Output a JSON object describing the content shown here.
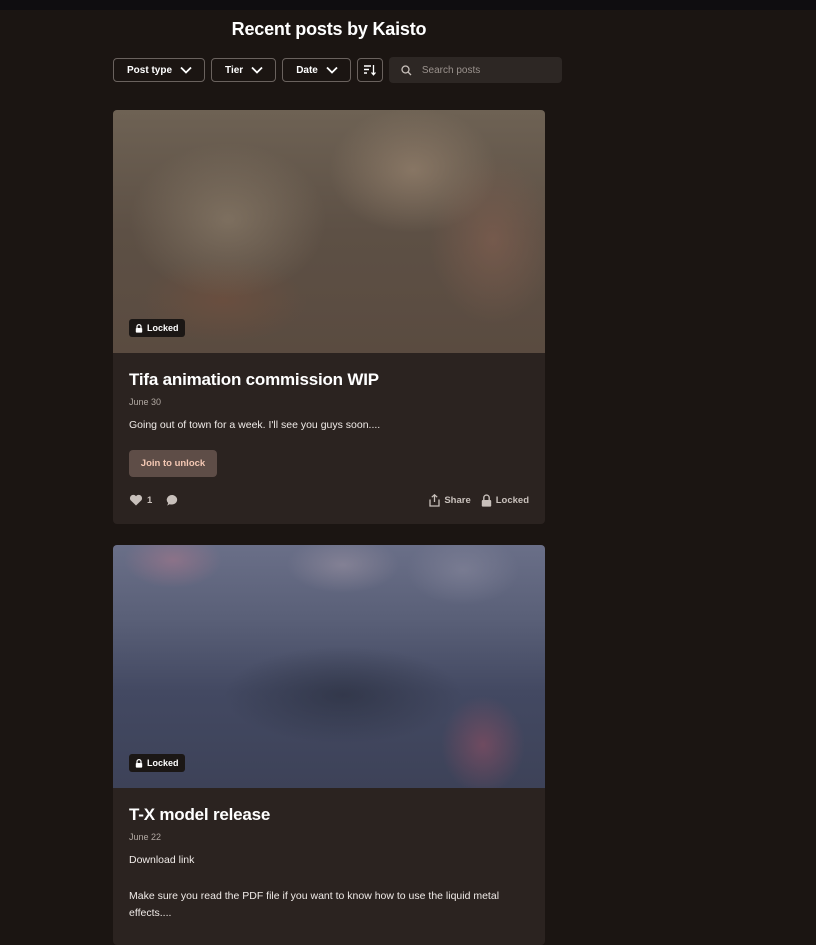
{
  "page": {
    "title": "Recent posts by Kaisto"
  },
  "filters": {
    "post_type": "Post type",
    "tier": "Tier",
    "date": "Date",
    "search_placeholder": "Search posts"
  },
  "posts": [
    {
      "badge": "Locked",
      "title": "Tifa animation commission WIP",
      "date": "June 30",
      "excerpt": "Going out of town for a week. I'll see you guys soon....",
      "cta": "Join to unlock",
      "likes": "1",
      "share_label": "Share",
      "locked_label": "Locked"
    },
    {
      "badge": "Locked",
      "title": "T-X model release",
      "date": "June 22",
      "excerpt": "Download link",
      "excerpt2": "Make sure you read the PDF file if you want to know how to use the liquid metal effects...."
    }
  ],
  "colors": {
    "background": "#1b1512",
    "card": "#2b2320",
    "cta_bg": "#5e4d47",
    "cta_text": "#f4c8b4"
  },
  "icons": [
    "chevron-down-icon",
    "sort-icon",
    "search-icon",
    "lock-icon",
    "heart-icon",
    "comment-icon",
    "share-icon"
  ]
}
